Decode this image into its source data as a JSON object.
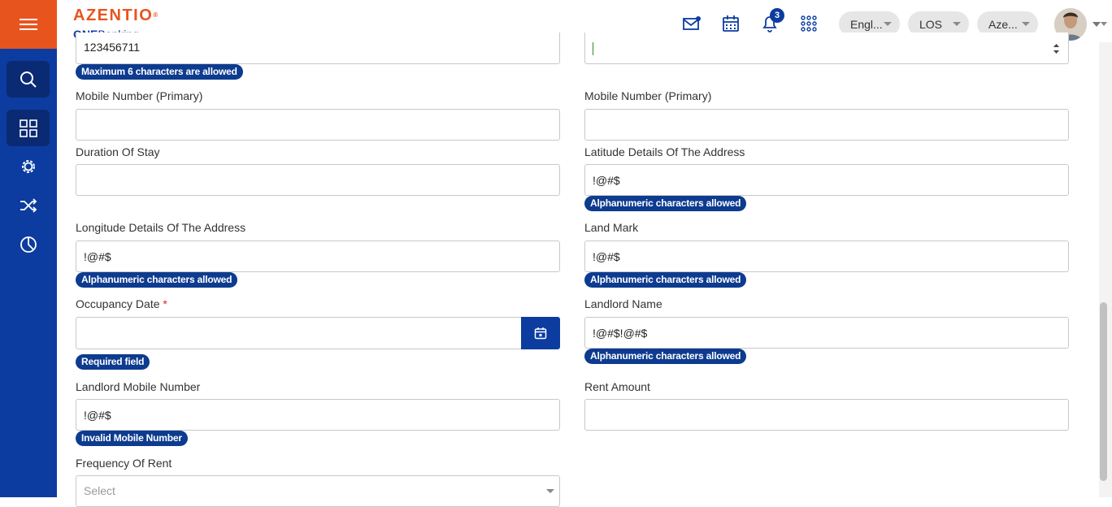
{
  "header": {
    "logo_main": "AZENTIO",
    "logo_reg": "®",
    "logo_sub_bold": "ONE",
    "logo_sub_rest": "Banking",
    "notification_count": "3",
    "language_pill": "Engl...",
    "module_pill": "LOS",
    "entity_pill": "Aze..."
  },
  "sidebar": {
    "items": [
      "search",
      "dashboard",
      "settings",
      "workflow",
      "reports"
    ]
  },
  "form": {
    "top_left_value": "123456711",
    "top_left_msg": "Maximum 6 characters are allowed",
    "top_right_value": "",
    "mobile_primary_left_label": "Mobile Number (Primary)",
    "mobile_primary_right_label": "Mobile Number (Primary)",
    "duration_label": "Duration Of Stay",
    "latitude_label": "Latitude Details Of The Address",
    "latitude_value": "!@#$",
    "latitude_msg": "Alphanumeric characters allowed",
    "longitude_label": "Longitude Details Of The Address",
    "longitude_value": "!@#$",
    "longitude_msg": "Alphanumeric characters allowed",
    "landmark_label": "Land Mark",
    "landmark_value": "!@#$",
    "landmark_msg": "Alphanumeric characters allowed",
    "occupancy_label": "Occupancy Date",
    "occupancy_required": "*",
    "occupancy_msg": "Required field",
    "landlord_name_label": "Landlord Name",
    "landlord_name_value": "!@#$!@#$",
    "landlord_name_msg": "Alphanumeric characters allowed",
    "landlord_mobile_label": "Landlord Mobile Number",
    "landlord_mobile_value": "!@#$",
    "landlord_mobile_msg": "Invalid Mobile Number",
    "rent_amount_label": "Rent Amount",
    "frequency_label": "Frequency Of Rent",
    "frequency_placeholder": "Select"
  },
  "colors": {
    "sidebar": "#0c3ca0",
    "accent_orange": "#e8541e",
    "error_badge": "#0d3b8f"
  }
}
